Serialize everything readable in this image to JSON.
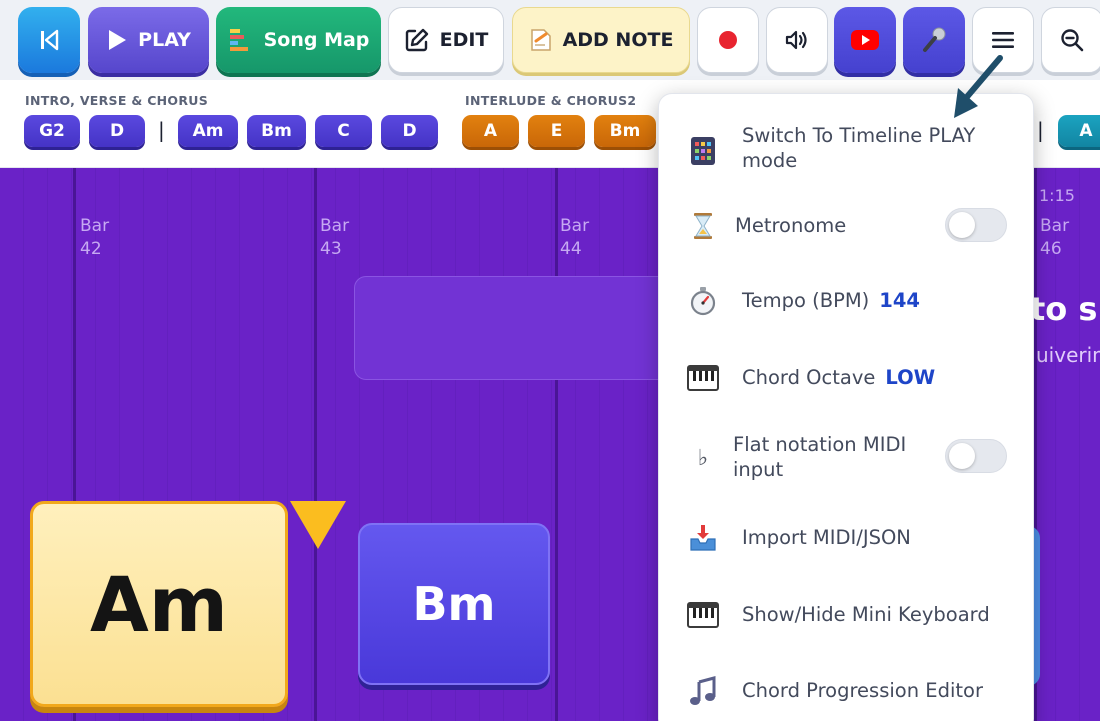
{
  "toolbar": {
    "play_label": "PLAY",
    "songmap_label": "Song Map",
    "edit_label": "EDIT",
    "addnote_label": "ADD NOTE",
    "icons": [
      "skip-to-start-icon",
      "play-icon",
      "song-map-icon",
      "edit-icon",
      "note-icon",
      "record-icon",
      "volume-icon",
      "youtube-icon",
      "microphone-icon",
      "menu-icon",
      "zoom-out-icon"
    ],
    "colors": {
      "play": "#5c4cd6",
      "songmap": "#1aa572",
      "restart": "#2496e6",
      "addnote": "#fdf3c8"
    }
  },
  "sections": {
    "intro_label": "INTRO, VERSE & CHORUS",
    "intro_chords": [
      "G2",
      "D",
      "|",
      "Am",
      "Bm",
      "C",
      "D"
    ],
    "interlude_label": "INTERLUDE & CHORUS2",
    "interlude_chords": [
      "A",
      "E",
      "Bm"
    ],
    "right_separator": "|",
    "right_chord": "A"
  },
  "timeline": {
    "bars": [
      {
        "word": "Bar",
        "num": "42"
      },
      {
        "word": "Bar",
        "num": "43"
      },
      {
        "word": "Bar",
        "num": "44"
      },
      {
        "word": "Bar",
        "num": "46"
      }
    ],
    "time": "1:15",
    "lyric_big": "to sh",
    "lyric_small": "uiverin",
    "current_chord": "Am",
    "next_chord": "Bm",
    "colors": {
      "background": "#6a22c7",
      "current_chord": "#fbe092",
      "next_chord": "#4938d9",
      "playhead": "#fbbd1f"
    }
  },
  "menu": {
    "timeline_mode": {
      "line1": "Switch To Timeline PLAY",
      "line2": "mode"
    },
    "metronome": {
      "label": "Metronome",
      "on": false
    },
    "tempo": {
      "label": "Tempo (BPM)",
      "value": "144"
    },
    "octave": {
      "label": "Chord Octave",
      "value": "LOW"
    },
    "flat_midi": {
      "line1": "Flat notation MIDI",
      "line2": "input",
      "on": false
    },
    "import": {
      "label": "Import MIDI/JSON"
    },
    "keyboard": {
      "label": "Show/Hide Mini Keyboard"
    },
    "progression": {
      "label": "Chord Progression Editor"
    },
    "flat_symbol": "♭"
  }
}
